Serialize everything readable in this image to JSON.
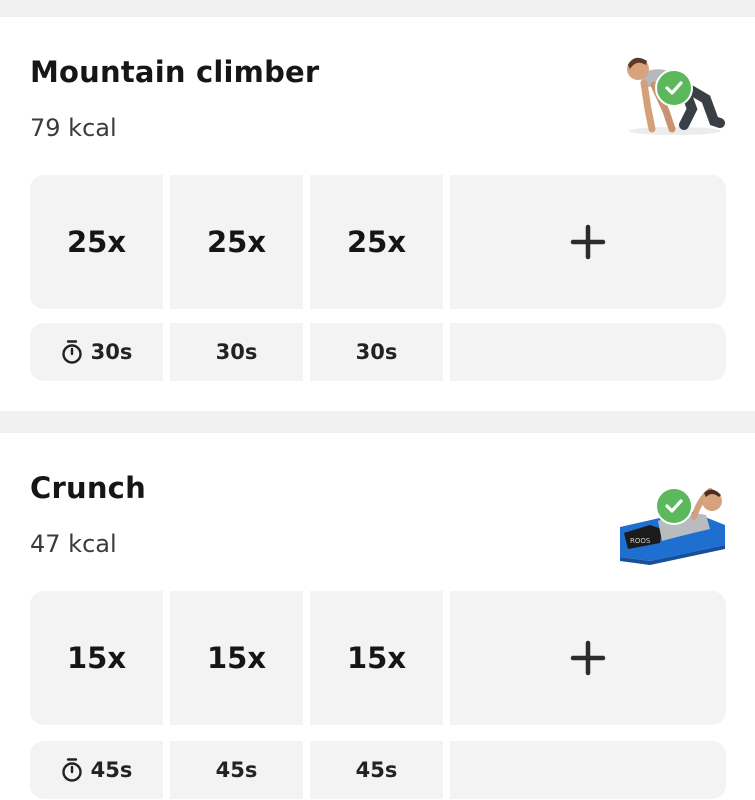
{
  "exercises": [
    {
      "name": "Mountain climber",
      "kcal": "79 kcal",
      "thumbnail": "mountain-climber-figure",
      "completed": true,
      "sets": [
        {
          "reps": "25x",
          "rest": "30s"
        },
        {
          "reps": "25x",
          "rest": "30s"
        },
        {
          "reps": "25x",
          "rest": "30s"
        }
      ],
      "add_set_icon": "plus-icon",
      "rest_icon": "stopwatch-icon"
    },
    {
      "name": "Crunch",
      "kcal": "47 kcal",
      "thumbnail": "crunch-figure",
      "completed": true,
      "sets": [
        {
          "reps": "15x",
          "rest": "45s"
        },
        {
          "reps": "15x",
          "rest": "45s"
        },
        {
          "reps": "15x",
          "rest": "45s"
        }
      ],
      "add_set_icon": "plus-icon",
      "rest_icon": "stopwatch-icon"
    }
  ],
  "colors": {
    "background": "#f1f1f1",
    "card": "#ffffff",
    "cell": "#f3f3f3",
    "check": "#5cb85c",
    "text": "#161616",
    "mat_blue": "#1f6fd1"
  }
}
